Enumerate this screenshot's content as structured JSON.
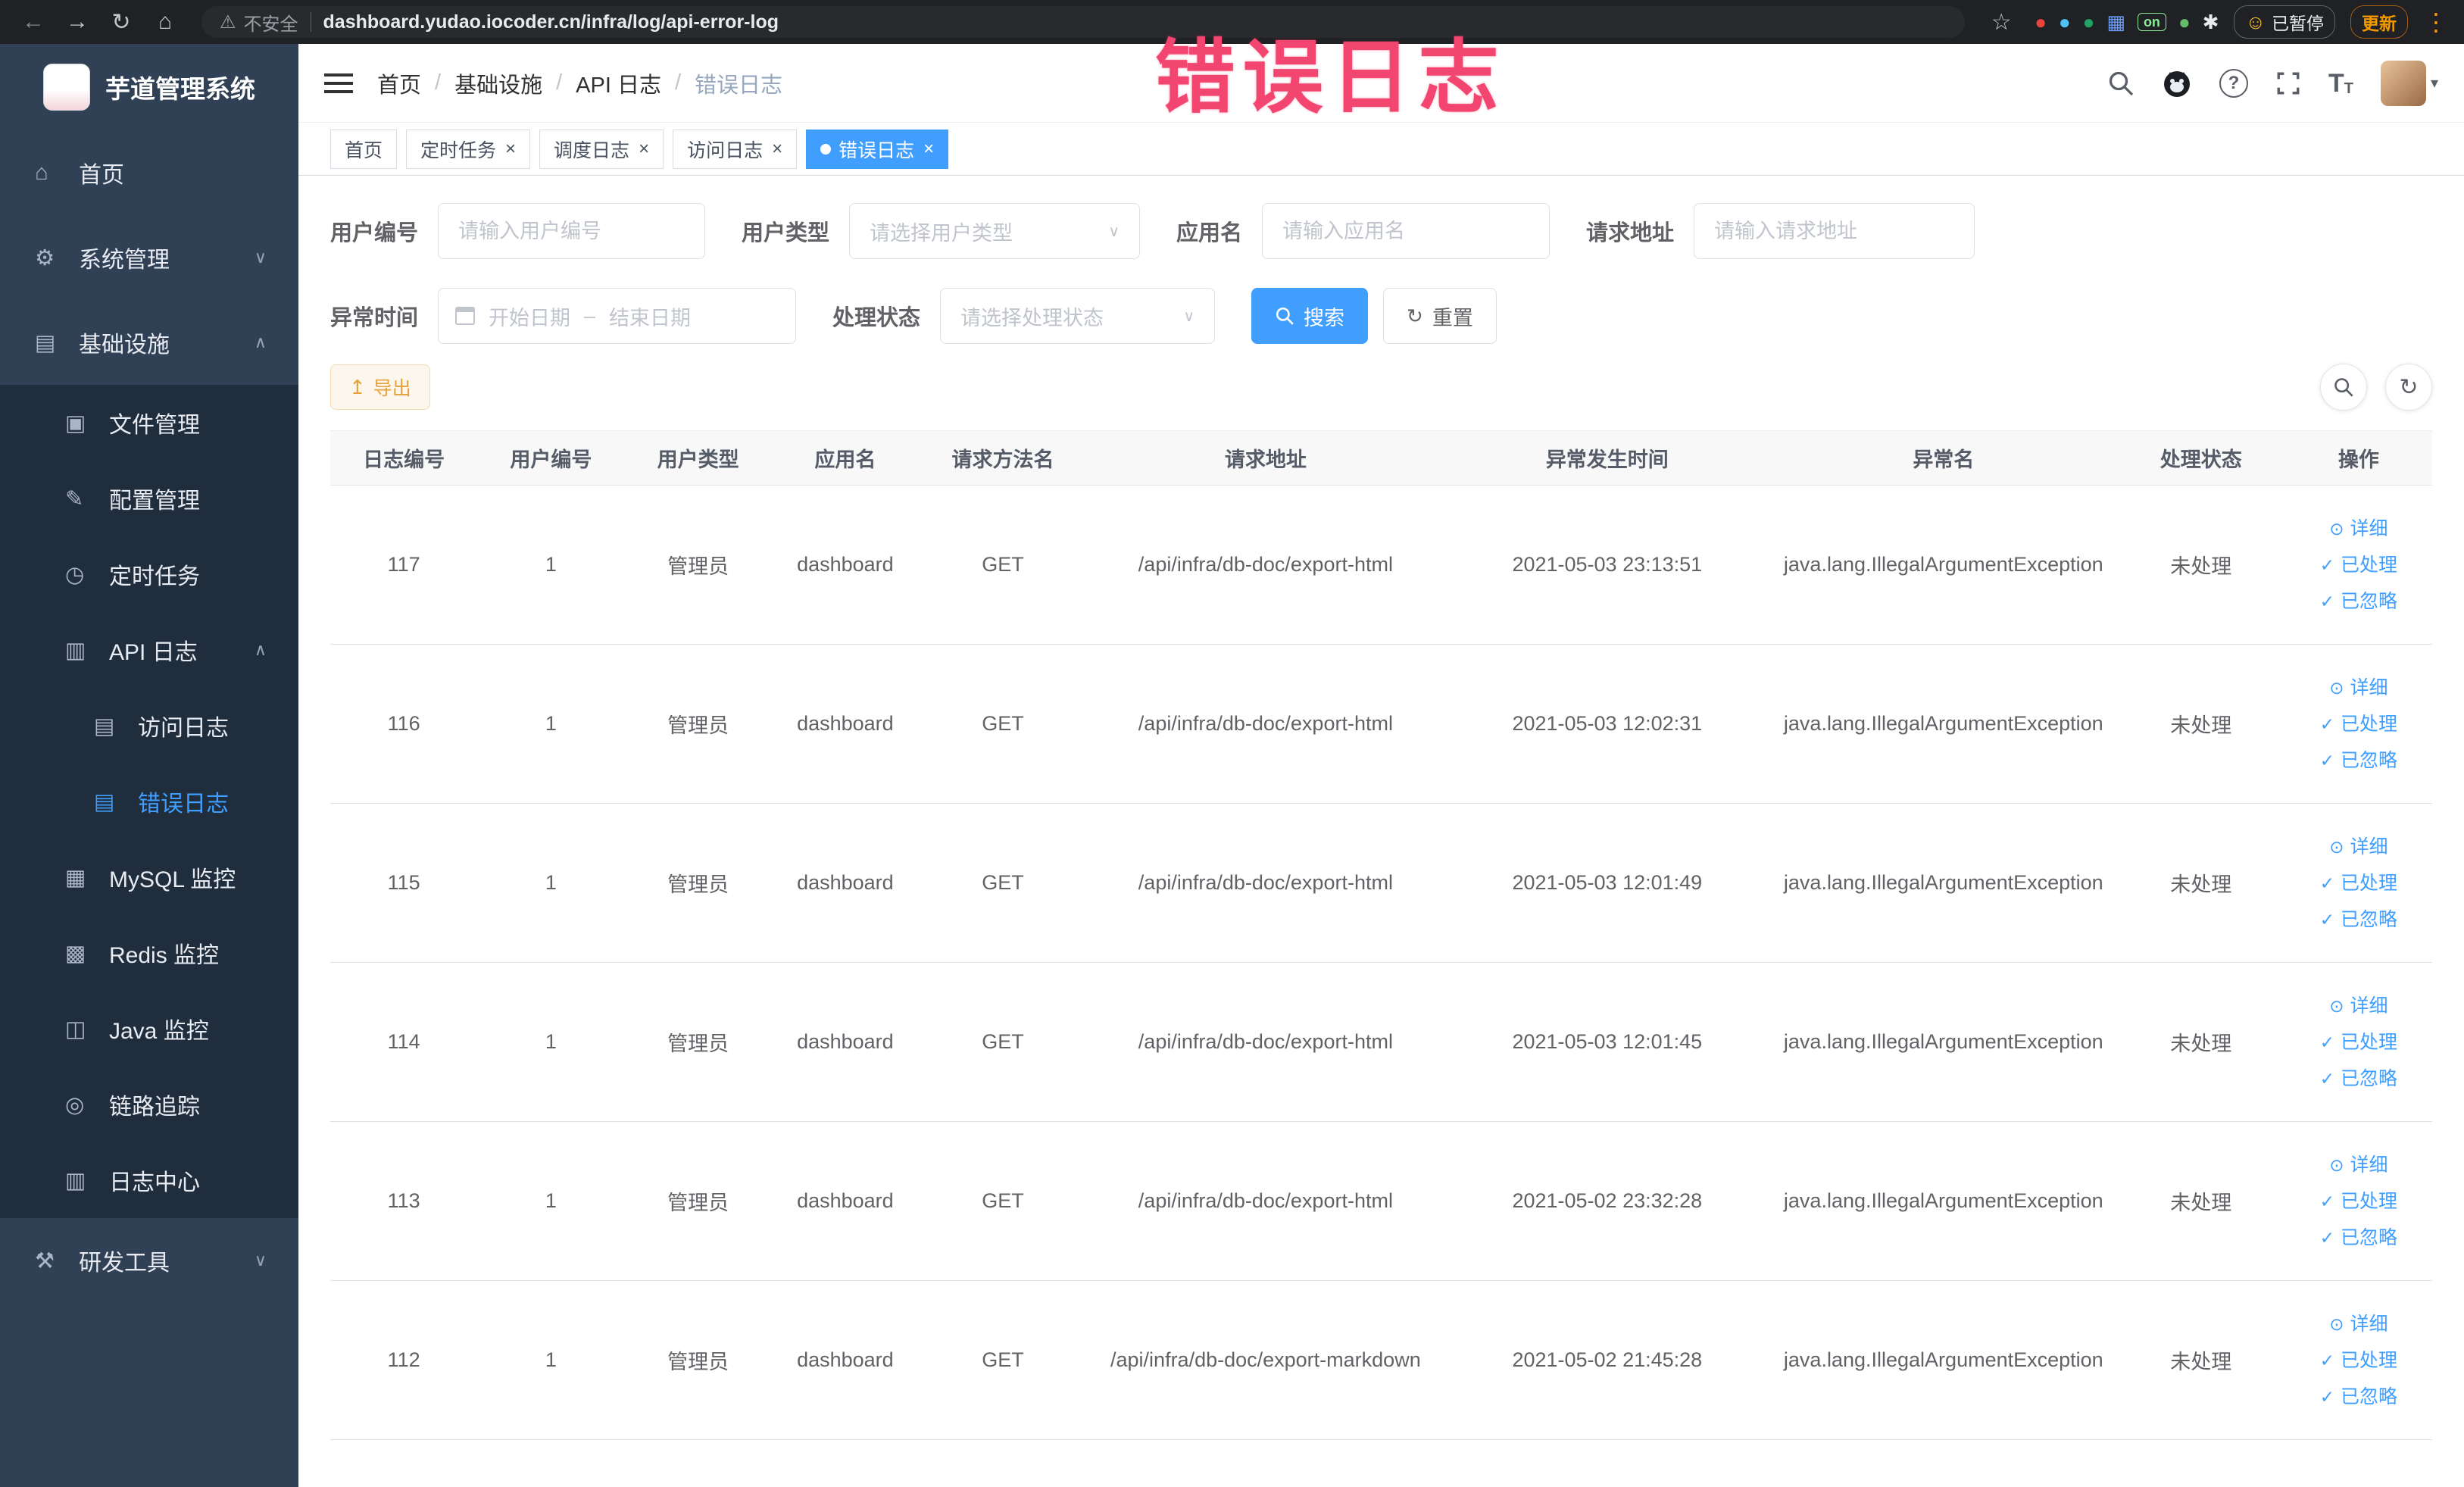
{
  "watermark": "错误日志",
  "browser": {
    "security_warning": "不安全",
    "url": "dashboard.yudao.iocoder.cn/infra/log/api-error-log",
    "paused_badge": "已暂停",
    "update_label": "更新",
    "extensions": [
      {
        "name": "ext-red-circle",
        "glyph": "●",
        "color": "#e8453c"
      },
      {
        "name": "ext-blue-drop",
        "glyph": "●",
        "color": "#4fc3f7"
      },
      {
        "name": "ext-green-circle",
        "glyph": "●",
        "color": "#21a366"
      },
      {
        "name": "ext-blue-grid",
        "glyph": "▦",
        "color": "#6a9bf7"
      },
      {
        "name": "ext-on-badge",
        "glyph": "on",
        "color": "#8ce99a",
        "chip": true
      },
      {
        "name": "ext-leaf",
        "glyph": "●",
        "color": "#66bb6a"
      },
      {
        "name": "ext-paw",
        "glyph": "✱",
        "color": "#e8eaed"
      }
    ]
  },
  "icons": {
    "back": "←",
    "forward": "→",
    "reload": "↻",
    "home": "⌂",
    "warning": "⚠",
    "star": "☆",
    "dots": "⋮",
    "smiley": "☺",
    "help": "?",
    "caret_down": "▾",
    "select_caret": "∨",
    "chevron_up": "∧",
    "chevron_down": "∨",
    "reset": "↻",
    "export": "↥",
    "refresh": "↻",
    "close": "×"
  },
  "sidebar": {
    "title": "芋道管理系统",
    "items": [
      {
        "name": "home",
        "label": "首页",
        "icon": "⌂",
        "level": 1
      },
      {
        "name": "system-management",
        "label": "系统管理",
        "icon": "⚙",
        "level": 1,
        "chevron": "down"
      },
      {
        "name": "infrastructure",
        "label": "基础设施",
        "icon": "▤",
        "level": 1,
        "chevron": "up"
      },
      {
        "name": "file-management",
        "label": "文件管理",
        "icon": "▣",
        "level": 2
      },
      {
        "name": "config-management",
        "label": "配置管理",
        "icon": "✎",
        "level": 2
      },
      {
        "name": "scheduled-jobs",
        "label": "定时任务",
        "icon": "◷",
        "level": 2
      },
      {
        "name": "api-log",
        "label": "API 日志",
        "icon": "▥",
        "level": 2,
        "chevron": "up"
      },
      {
        "name": "access-log",
        "label": "访问日志",
        "icon": "▤",
        "level": 3
      },
      {
        "name": "error-log",
        "label": "错误日志",
        "icon": "▤",
        "level": 3,
        "active": true
      },
      {
        "name": "mysql-monitor",
        "label": "MySQL 监控",
        "icon": "▦",
        "level": 2
      },
      {
        "name": "redis-monitor",
        "label": "Redis 监控",
        "icon": "▩",
        "level": 2
      },
      {
        "name": "java-monitor",
        "label": "Java 监控",
        "icon": "◫",
        "level": 2
      },
      {
        "name": "link-trace",
        "label": "链路追踪",
        "icon": "◎",
        "level": 2
      },
      {
        "name": "log-center",
        "label": "日志中心",
        "icon": "▥",
        "level": 2
      },
      {
        "name": "dev-tools",
        "label": "研发工具",
        "icon": "⚒",
        "level": 1,
        "chevron": "down"
      }
    ]
  },
  "navbar": {
    "breadcrumb": [
      "首页",
      "基础设施",
      "API 日志",
      "错误日志"
    ]
  },
  "tabs": [
    {
      "name": "home",
      "label": "首页",
      "closable": false,
      "active": false
    },
    {
      "name": "scheduled-jobs",
      "label": "定时任务",
      "closable": true,
      "active": false
    },
    {
      "name": "job-log",
      "label": "调度日志",
      "closable": true,
      "active": false
    },
    {
      "name": "access-log",
      "label": "访问日志",
      "closable": true,
      "active": false
    },
    {
      "name": "error-log",
      "label": "错误日志",
      "closable": true,
      "active": true
    }
  ],
  "filters": {
    "user_id": {
      "label": "用户编号",
      "placeholder": "请输入用户编号"
    },
    "user_type": {
      "label": "用户类型",
      "placeholder": "请选择用户类型"
    },
    "app_name": {
      "label": "应用名",
      "placeholder": "请输入应用名"
    },
    "request_url": {
      "label": "请求地址",
      "placeholder": "请输入请求地址"
    },
    "exception_time": {
      "label": "异常时间",
      "start_placeholder": "开始日期",
      "end_placeholder": "结束日期",
      "separator": "–"
    },
    "process_status": {
      "label": "处理状态",
      "placeholder": "请选择处理状态"
    },
    "search_label": "搜索",
    "reset_label": "重置"
  },
  "toolbar": {
    "export_label": "导出"
  },
  "table": {
    "columns": [
      "日志编号",
      "用户编号",
      "用户类型",
      "应用名",
      "请求方法名",
      "请求地址",
      "异常发生时间",
      "异常名",
      "处理状态",
      "操作"
    ],
    "actions": [
      {
        "name": "detail",
        "label": "详细",
        "icon": "⊙"
      },
      {
        "name": "processed",
        "label": "已处理",
        "icon": "✓"
      },
      {
        "name": "ignored",
        "label": "已忽略",
        "icon": "✓"
      }
    ],
    "rows": [
      {
        "id": "117",
        "user_id": "1",
        "user_type": "管理员",
        "app": "dashboard",
        "method": "GET",
        "url": "/api/infra/db-doc/export-html",
        "time": "2021-05-03 23:13:51",
        "exception": "java.lang.IllegalArgumentException",
        "status": "未处理"
      },
      {
        "id": "116",
        "user_id": "1",
        "user_type": "管理员",
        "app": "dashboard",
        "method": "GET",
        "url": "/api/infra/db-doc/export-html",
        "time": "2021-05-03 12:02:31",
        "exception": "java.lang.IllegalArgumentException",
        "status": "未处理"
      },
      {
        "id": "115",
        "user_id": "1",
        "user_type": "管理员",
        "app": "dashboard",
        "method": "GET",
        "url": "/api/infra/db-doc/export-html",
        "time": "2021-05-03 12:01:49",
        "exception": "java.lang.IllegalArgumentException",
        "status": "未处理"
      },
      {
        "id": "114",
        "user_id": "1",
        "user_type": "管理员",
        "app": "dashboard",
        "method": "GET",
        "url": "/api/infra/db-doc/export-html",
        "time": "2021-05-03 12:01:45",
        "exception": "java.lang.IllegalArgumentException",
        "status": "未处理"
      },
      {
        "id": "113",
        "user_id": "1",
        "user_type": "管理员",
        "app": "dashboard",
        "method": "GET",
        "url": "/api/infra/db-doc/export-html",
        "time": "2021-05-02 23:32:28",
        "exception": "java.lang.IllegalArgumentException",
        "status": "未处理"
      },
      {
        "id": "112",
        "user_id": "1",
        "user_type": "管理员",
        "app": "dashboard",
        "method": "GET",
        "url": "/api/infra/db-doc/export-markdown",
        "time": "2021-05-02 21:45:28",
        "exception": "java.lang.IllegalArgumentException",
        "status": "未处理"
      }
    ]
  },
  "colors": {
    "accent_blue": "#409eff",
    "sidebar_bg": "#304156",
    "submenu_bg": "#1f2d3d",
    "warning_button": "#e6a23c",
    "watermark_pink": "#f2456f",
    "chrome_bg": "#202124"
  }
}
